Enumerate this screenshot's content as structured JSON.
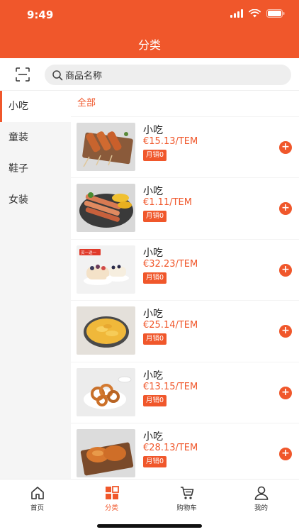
{
  "status_bar": {
    "time": "9:49"
  },
  "header": {
    "title": "分类"
  },
  "search": {
    "placeholder": "商品名称"
  },
  "sidebar": {
    "items": [
      {
        "label": "小吃",
        "active": true
      },
      {
        "label": "童装",
        "active": false
      },
      {
        "label": "鞋子",
        "active": false
      },
      {
        "label": "女装",
        "active": false
      }
    ]
  },
  "content": {
    "category_label": "全部",
    "products": [
      {
        "name": "小吃",
        "price": "€15.13/TEM",
        "sales": "月销0",
        "add_label": "+",
        "image": "chicken-skewers"
      },
      {
        "name": "小吃",
        "price": "€1.11/TEM",
        "sales": "月销0",
        "add_label": "+",
        "image": "grilled-skewers-corn"
      },
      {
        "name": "小吃",
        "price": "€32.23/TEM",
        "sales": "月销0",
        "add_label": "+",
        "image": "cakes-promo"
      },
      {
        "name": "小吃",
        "price": "€25.14/TEM",
        "sales": "月销0",
        "add_label": "+",
        "image": "pizza"
      },
      {
        "name": "小吃",
        "price": "€13.15/TEM",
        "sales": "月销0",
        "add_label": "+",
        "image": "onion-rings"
      },
      {
        "name": "小吃",
        "price": "€28.13/TEM",
        "sales": "月销0",
        "add_label": "+",
        "image": "chicken-wings"
      }
    ],
    "promo_tag": "买一送一"
  },
  "tabbar": {
    "tabs": [
      {
        "label": "首页",
        "icon": "home-icon"
      },
      {
        "label": "分类",
        "icon": "category-icon",
        "active": true
      },
      {
        "label": "购物车",
        "icon": "cart-icon"
      },
      {
        "label": "我的",
        "icon": "user-icon"
      }
    ]
  },
  "colors": {
    "accent": "#f0572b",
    "sidebar_bg": "#f5f5f5",
    "search_bg": "#eeeeee"
  }
}
